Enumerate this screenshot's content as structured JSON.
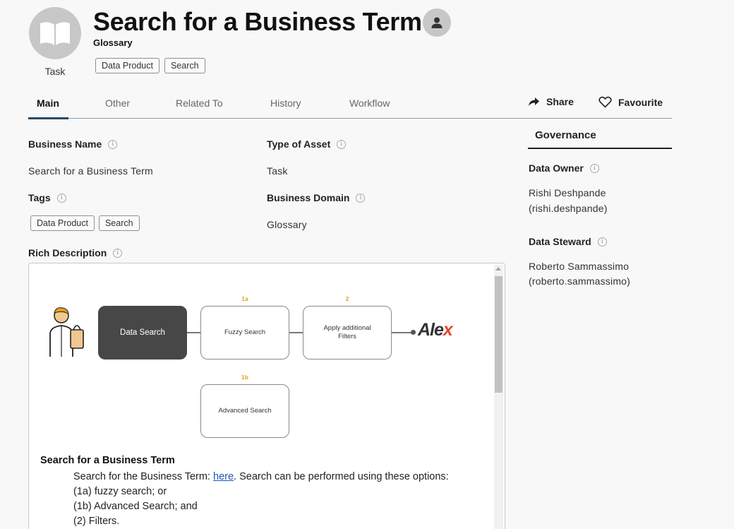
{
  "header": {
    "title": "Search for a Business Term",
    "subtitle": "Glossary",
    "asset_type": "Task",
    "tags": [
      "Data Product",
      "Search"
    ]
  },
  "tabs": [
    "Main",
    "Other",
    "Related To",
    "History",
    "Workflow"
  ],
  "active_tab": "Main",
  "actions": {
    "share": "Share",
    "favourite": "Favourite"
  },
  "fields": {
    "business_name_label": "Business Name",
    "business_name_value": "Search for a Business Term",
    "type_label": "Type of Asset",
    "type_value": "Task",
    "tags_label": "Tags",
    "tags": [
      "Data Product",
      "Search"
    ],
    "domain_label": "Business Domain",
    "domain_value": "Glossary",
    "rich_desc_label": "Rich Description"
  },
  "governance": {
    "title": "Governance",
    "owner_label": "Data Owner",
    "owner_name": "Rishi Deshpande",
    "owner_id": "(rishi.deshpande)",
    "steward_label": "Data Steward",
    "steward_name": "Roberto Sammassimo",
    "steward_id": "(roberto.sammassimo)"
  },
  "diagram": {
    "start": "Data Search",
    "fuzzy": "Fuzzy Search",
    "fuzzy_step": "1a",
    "filters_line1": "Apply additional",
    "filters_line2": "Filters",
    "filters_step": "2",
    "advanced": "Advanced Search",
    "advanced_step": "1b",
    "logo_main": "Ale",
    "logo_x": "x"
  },
  "description": {
    "heading": "Search for a Business Term",
    "line1_pre": "Search for the Business Term: ",
    "line1_link": "here",
    "line1_post": ". Search can be performed using these options:",
    "line2": "(1a) fuzzy search; or",
    "line3": "(1b) Advanced Search; and",
    "line4": "(2) Filters."
  },
  "colors": {
    "accent": "#2c4a63",
    "step": "#e6a01a",
    "logo_x": "#e04a2c",
    "dark_box": "#474747"
  }
}
